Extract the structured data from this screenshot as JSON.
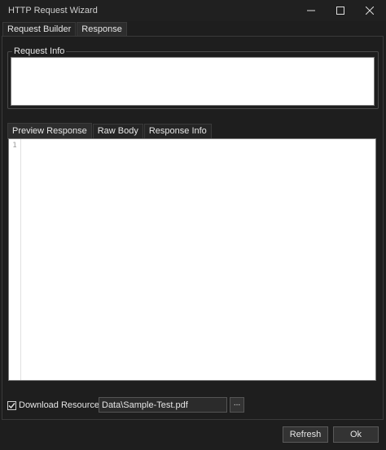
{
  "window": {
    "title": "HTTP Request Wizard",
    "controls": [
      "minimize-icon",
      "maximize-icon",
      "close-icon"
    ]
  },
  "outer_tabs": [
    {
      "label": "Request Builder",
      "active": false
    },
    {
      "label": "Response",
      "active": true
    }
  ],
  "request_info": {
    "legend": "Request Info",
    "content": ""
  },
  "response_tabs": [
    {
      "label": "Preview Response",
      "active": true
    },
    {
      "label": "Raw Body",
      "active": false
    },
    {
      "label": "Response Info",
      "active": false
    }
  ],
  "editor": {
    "line_numbers": [
      "1"
    ],
    "content": ""
  },
  "download": {
    "label": "Download Resource",
    "checked": true,
    "path": "Data\\Sample-Test.pdf",
    "browse_label": "..."
  },
  "footer": {
    "refresh_label": "Refresh",
    "ok_label": "Ok"
  },
  "colors": {
    "background": "#1e1e1e",
    "text": "#e6e6e6",
    "panel_border": "#3a3a3a",
    "editor_bg": "#ffffff"
  }
}
